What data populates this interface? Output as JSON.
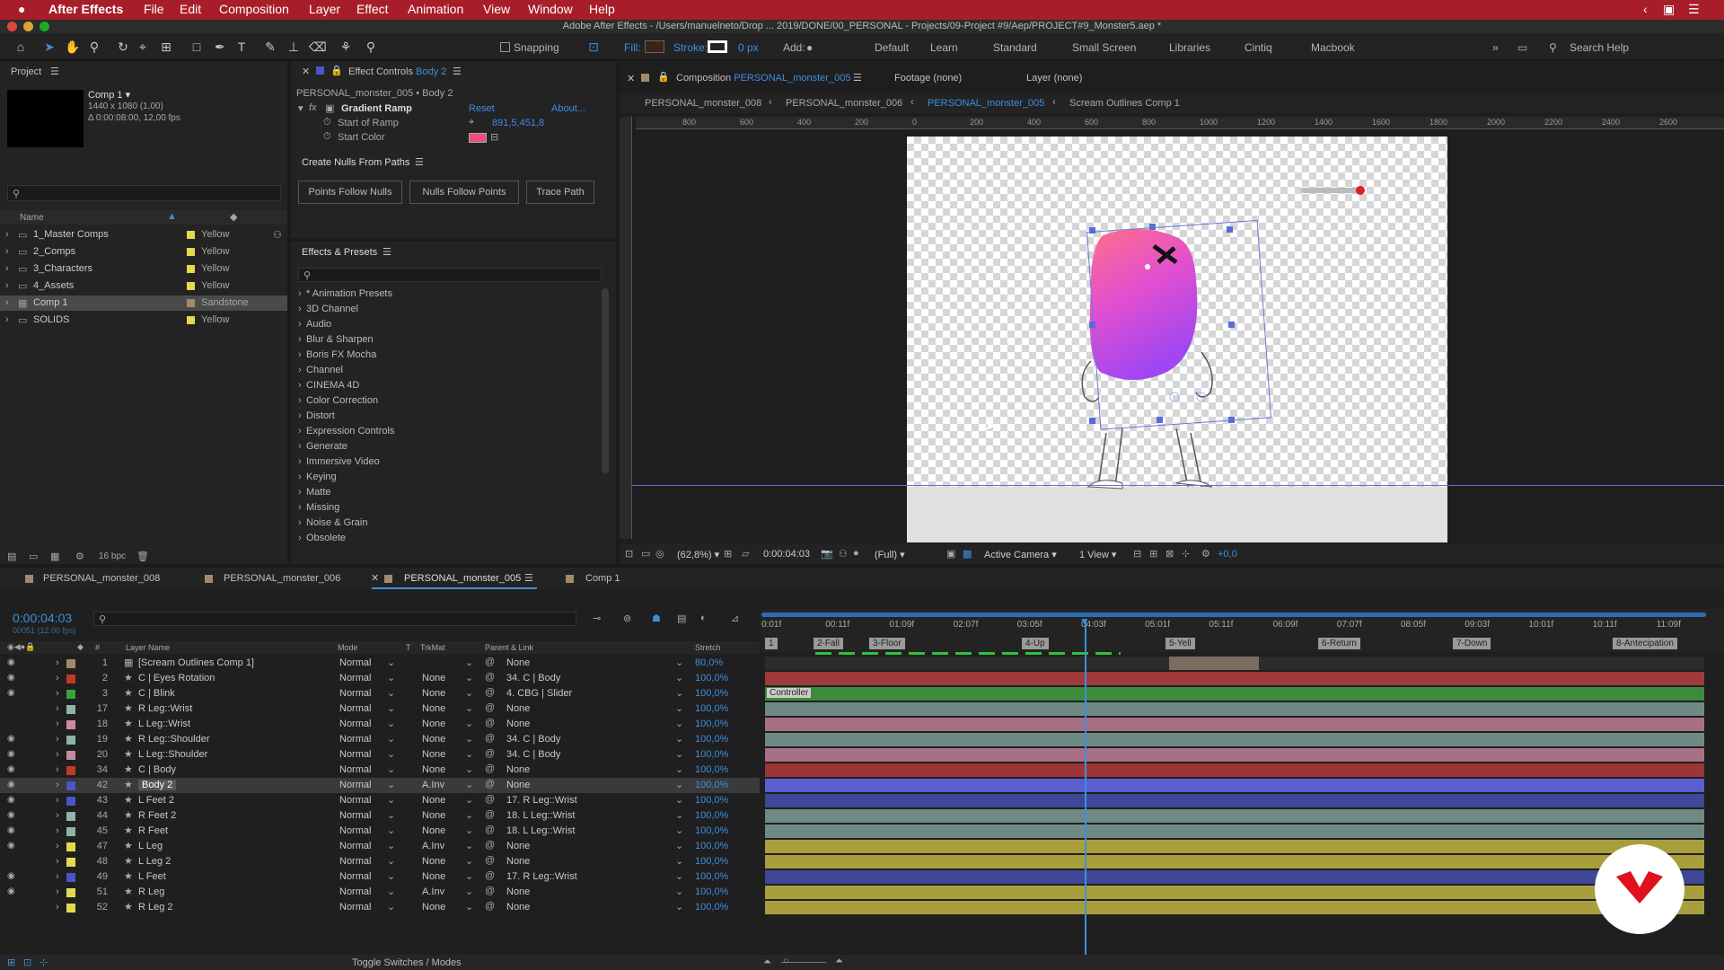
{
  "menubar": {
    "app": "After Effects",
    "items": [
      "File",
      "Edit",
      "Composition",
      "Layer",
      "Effect",
      "Animation",
      "View",
      "Window",
      "Help"
    ]
  },
  "titlebar": {
    "title": "Adobe After Effects - /Users/manuelneto/Drop ... 2019/DONE/00_PERSONAL - Projects/09-Project #9/Aep/PROJECT#9_Monster5.aep *"
  },
  "toolbar": {
    "snapping": "Snapping",
    "fill": "Fill:",
    "stroke": "Stroke:",
    "stroke_px": "0 px",
    "add": "Add:",
    "workspaces": [
      "Default",
      "Learn",
      "Standard",
      "Small Screen",
      "Libraries",
      "Cintiq",
      "Macbook"
    ],
    "search_placeholder": "Search Help"
  },
  "project": {
    "tab": "Project",
    "comp_name": "Comp 1 ▾",
    "comp_info1": "1440 x 1080 (1,00)",
    "comp_info2": "Δ 0:00:08:00, 12,00 fps",
    "col_name": "Name",
    "bpc": "16 bpc",
    "items": [
      {
        "name": "1_Master Comps",
        "label": "Yellow",
        "color": "#e4d84c"
      },
      {
        "name": "2_Comps",
        "label": "Yellow",
        "color": "#e4d84c"
      },
      {
        "name": "3_Characters",
        "label": "Yellow",
        "color": "#e4d84c"
      },
      {
        "name": "4_Assets",
        "label": "Yellow",
        "color": "#e4d84c"
      },
      {
        "name": "Comp 1",
        "label": "Sandstone",
        "color": "#a08a6a"
      },
      {
        "name": "SOLIDS",
        "label": "Yellow",
        "color": "#e4d84c"
      }
    ]
  },
  "effect_controls": {
    "tab_prefix": "Effect Controls",
    "tab_layer": "Body 2",
    "subtitle": "PERSONAL_monster_005 • Body 2",
    "effect": "Gradient Ramp",
    "reset": "Reset",
    "about": "About...",
    "start_of_ramp": "Start of Ramp",
    "start_value": "891,5,451,8",
    "start_color": "Start Color"
  },
  "nulls": {
    "title": "Create Nulls From Paths",
    "buttons": [
      "Points Follow Nulls",
      "Nulls Follow Points",
      "Trace Path"
    ]
  },
  "effects_presets": {
    "title": "Effects & Presets",
    "items": [
      "* Animation Presets",
      "3D Channel",
      "Audio",
      "Blur & Sharpen",
      "Boris FX Mocha",
      "Channel",
      "CINEMA 4D",
      "Color Correction",
      "Distort",
      "Expression Controls",
      "Generate",
      "Immersive Video",
      "Keying",
      "Matte",
      "Missing",
      "Noise & Grain",
      "Obsolete"
    ]
  },
  "composition": {
    "tab_prefix": "Composition",
    "tab_name": "PERSONAL_monster_005",
    "footage": "Footage (none)",
    "layer": "Layer (none)",
    "crumbs": [
      "PERSONAL_monster_008",
      "PERSONAL_monster_006",
      "PERSONAL_monster_005",
      "Scream Outlines Comp 1"
    ],
    "ruler": [
      "800",
      "600",
      "400",
      "200",
      "0",
      "200",
      "400",
      "600",
      "800",
      "1000",
      "1200",
      "1400",
      "1600",
      "1800",
      "2000",
      "2200",
      "2400",
      "2600"
    ],
    "footer": {
      "zoom": "(62,8%)",
      "time": "0:00:04:03",
      "res": "(Full)",
      "camera": "Active Camera",
      "view": "1 View",
      "offset": "+0,0"
    }
  },
  "timeline": {
    "tabs": [
      "PERSONAL_monster_008",
      "PERSONAL_monster_006",
      "PERSONAL_monster_005",
      "Comp 1"
    ],
    "timecode": "0:00:04:03",
    "frames": "00051 (12.00 fps)",
    "cols": {
      "num": "#",
      "name": "Layer Name",
      "mode": "Mode",
      "t": "T",
      "trkmat": "TrkMat",
      "parent": "Parent & Link",
      "stretch": "Stretch"
    },
    "ticks": [
      "0:01f",
      "00:11f",
      "01:09f",
      "02:07f",
      "03:05f",
      "04:03f",
      "05:01f",
      "05:11f",
      "06:09f",
      "07:07f",
      "08:05f",
      "09:03f",
      "10:01f",
      "10:11f",
      "11:09f"
    ],
    "markers": [
      "1",
      "2-Fall",
      "3-Floor",
      "4-Up",
      "5-Yell",
      "6-Return",
      "7-Down",
      "8-Antecipation"
    ],
    "controller": "Controller",
    "toggle": "Toggle Switches / Modes",
    "layers": [
      {
        "num": "1",
        "name": "[Scream Outlines Comp 1]",
        "mode": "Normal",
        "trk": "",
        "parent": "None",
        "stretch": "80,0%",
        "color": "#a08a6a",
        "bar": "#7a6d5e"
      },
      {
        "num": "2",
        "name": "C | Eyes Rotation",
        "mode": "Normal",
        "trk": "None",
        "parent": "34. C | Body",
        "stretch": "100,0%",
        "color": "#c0392b",
        "bar": "#a03a3a"
      },
      {
        "num": "3",
        "name": "C | Blink",
        "mode": "Normal",
        "trk": "None",
        "parent": "4. CBG | Slider",
        "stretch": "100,0%",
        "color": "#3aa23a",
        "bar": "#3d8a3d"
      },
      {
        "num": "17",
        "name": "R Leg::Wrist",
        "mode": "Normal",
        "trk": "None",
        "parent": "None",
        "stretch": "100,0%",
        "color": "#8fb3a8",
        "bar": "#6f8a84"
      },
      {
        "num": "18",
        "name": "L Leg::Wrist",
        "mode": "Normal",
        "trk": "None",
        "parent": "None",
        "stretch": "100,0%",
        "color": "#c98aa0",
        "bar": "#a87085"
      },
      {
        "num": "19",
        "name": "R Leg::Shoulder",
        "mode": "Normal",
        "trk": "None",
        "parent": "34. C | Body",
        "stretch": "100,0%",
        "color": "#8fb3a8",
        "bar": "#6f8a84"
      },
      {
        "num": "20",
        "name": "L Leg::Shoulder",
        "mode": "Normal",
        "trk": "None",
        "parent": "34. C | Body",
        "stretch": "100,0%",
        "color": "#c98aa0",
        "bar": "#a87085"
      },
      {
        "num": "34",
        "name": "C | Body",
        "mode": "Normal",
        "trk": "None",
        "parent": "None",
        "stretch": "100,0%",
        "color": "#c0392b",
        "bar": "#9e3535"
      },
      {
        "num": "42",
        "name": "Body 2",
        "mode": "Normal",
        "trk": "A.Inv",
        "parent": "None",
        "stretch": "100,0%",
        "color": "#4b54c8",
        "bar": "#5a5fcf"
      },
      {
        "num": "43",
        "name": "L Feet 2",
        "mode": "Normal",
        "trk": "None",
        "parent": "17. R Leg::Wrist",
        "stretch": "100,0%",
        "color": "#4b54c8",
        "bar": "#3f4796"
      },
      {
        "num": "44",
        "name": "R Feet 2",
        "mode": "Normal",
        "trk": "None",
        "parent": "18. L Leg::Wrist",
        "stretch": "100,0%",
        "color": "#8fb3a8",
        "bar": "#6f8a84"
      },
      {
        "num": "45",
        "name": "R Feet",
        "mode": "Normal",
        "trk": "None",
        "parent": "18. L Leg::Wrist",
        "stretch": "100,0%",
        "color": "#8fb3a8",
        "bar": "#6f8a84"
      },
      {
        "num": "47",
        "name": "L Leg",
        "mode": "Normal",
        "trk": "A.Inv",
        "parent": "None",
        "stretch": "100,0%",
        "color": "#e4d84c",
        "bar": "#a89e3c"
      },
      {
        "num": "48",
        "name": "L Leg 2",
        "mode": "Normal",
        "trk": "None",
        "parent": "None",
        "stretch": "100,0%",
        "color": "#e4d84c",
        "bar": "#a89e3c"
      },
      {
        "num": "49",
        "name": "L Feet",
        "mode": "Normal",
        "trk": "None",
        "parent": "17. R Leg::Wrist",
        "stretch": "100,0%",
        "color": "#4b54c8",
        "bar": "#3f4796"
      },
      {
        "num": "51",
        "name": "R Leg",
        "mode": "Normal",
        "trk": "A.Inv",
        "parent": "None",
        "stretch": "100,0%",
        "color": "#e4d84c",
        "bar": "#a89e3c"
      },
      {
        "num": "52",
        "name": "R Leg 2",
        "mode": "Normal",
        "trk": "None",
        "parent": "None",
        "stretch": "100,0%",
        "color": "#e4d84c",
        "bar": "#a89e3c"
      }
    ]
  }
}
